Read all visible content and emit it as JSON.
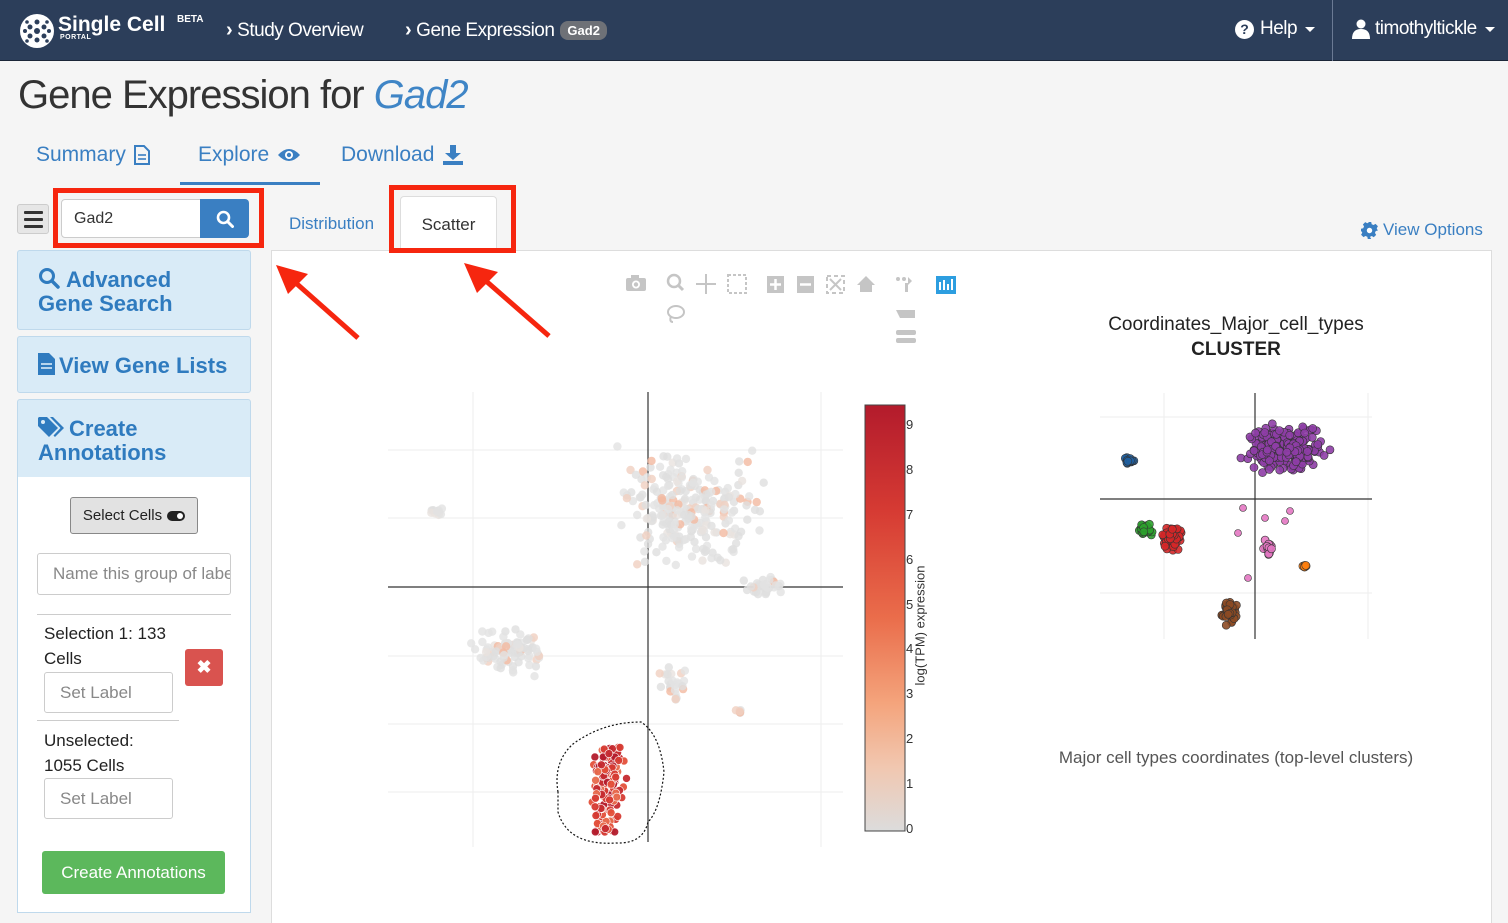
{
  "navbar": {
    "brand": "Single Cell",
    "brand_sub": "PORTAL",
    "beta": "BETA",
    "crumbs": [
      "Study Overview",
      "Gene Expression"
    ],
    "gene_badge": "Gad2",
    "help": "Help",
    "user": "timothyltickle"
  },
  "page": {
    "title_prefix": "Gene Expression for ",
    "title_gene": "Gad2"
  },
  "tabs": [
    {
      "label": "Summary",
      "icon": "document-icon"
    },
    {
      "label": "Explore",
      "icon": "eye-icon",
      "active": true
    },
    {
      "label": "Download",
      "icon": "download-icon"
    }
  ],
  "search": {
    "value": "Gad2"
  },
  "subtabs": {
    "distribution": "Distribution",
    "scatter": "Scatter",
    "active": "Scatter"
  },
  "view_options": "View Options",
  "sidebar": {
    "advanced_search": [
      "Advanced",
      "Gene Search"
    ],
    "gene_lists": "View Gene Lists",
    "create_annotations": [
      "Create",
      "Annotations"
    ],
    "select_cells": "Select Cells",
    "group_placeholder": "Name this group of labels",
    "selection_1": [
      "Selection 1: 133",
      "Cells"
    ],
    "unselected": [
      "Unselected:",
      "1055 Cells"
    ],
    "set_label_placeholder": "Set Label",
    "create_button": "Create Annotations"
  },
  "expression_plot": {
    "colorbar_title": "log(TPM) expression",
    "colorbar_ticks": [
      "9",
      "8",
      "7",
      "6",
      "5",
      "4",
      "3",
      "2",
      "1",
      "0"
    ],
    "colorbar_range": [
      0,
      9.2
    ]
  },
  "cluster_plot": {
    "title": "Coordinates_Major_cell_types",
    "subtitle": "CLUSTER",
    "description": "Major cell types coordinates (top-level clusters)",
    "cluster_colors": [
      "#1f5fa0",
      "#8e3da6",
      "#2ca02c",
      "#d62728",
      "#e377c2",
      "#ff7f0e",
      "#8c4a24"
    ]
  },
  "colors": {
    "navbar": "#2c3e5a",
    "accent": "#3a7fc2",
    "highlight": "#f6260f",
    "success": "#5cb85c",
    "danger": "#d9534f"
  }
}
